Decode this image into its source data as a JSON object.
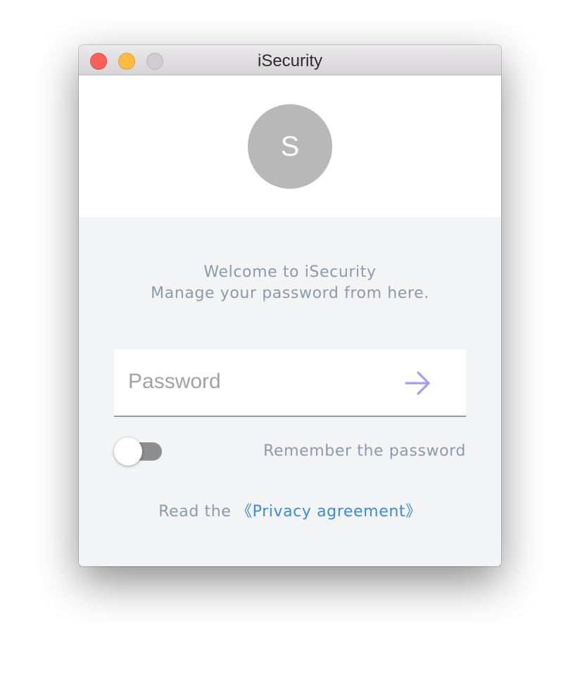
{
  "window": {
    "title": "iSecurity"
  },
  "avatar": {
    "initial": "S",
    "color": "#b8b8b8"
  },
  "welcome": {
    "line1": "Welcome to iSecurity",
    "line2": "Manage your password from here."
  },
  "password": {
    "placeholder": "Password",
    "value": "",
    "submit_icon": "arrow-right-icon",
    "accent": "#a79cf0"
  },
  "remember": {
    "label": "Remember the password",
    "enabled": false
  },
  "privacy": {
    "prefix": "Read the",
    "link": "《Privacy agreement》",
    "link_color": "#3c8ad9"
  }
}
